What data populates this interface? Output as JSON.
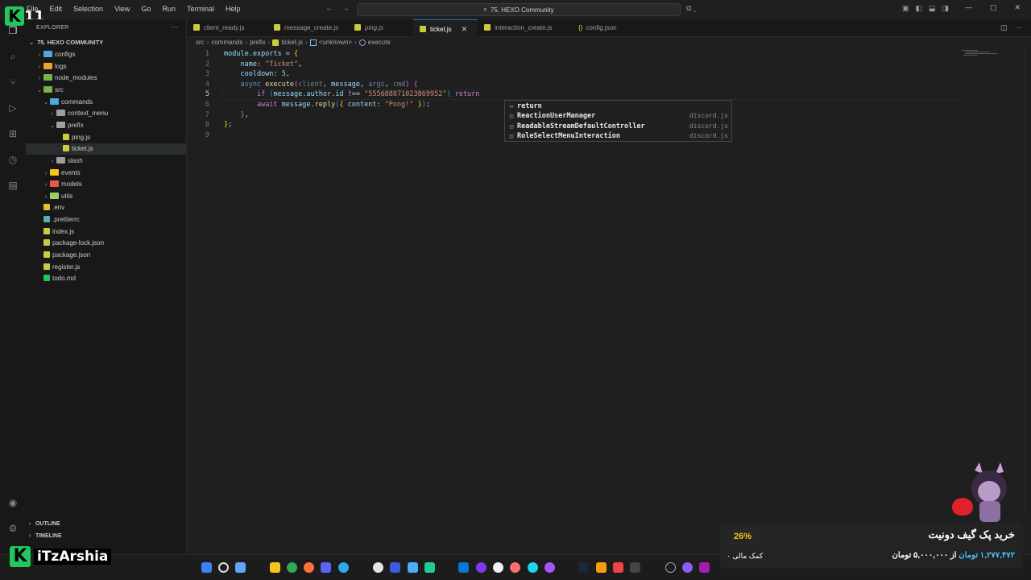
{
  "logo": {
    "number": "11"
  },
  "menu": [
    "File",
    "Edit",
    "Selection",
    "View",
    "Go",
    "Run",
    "Terminal",
    "Help"
  ],
  "search": {
    "text": "75. HEXO Community"
  },
  "sidebar": {
    "header": "EXPLORER",
    "root": "75. HEXO COMMUNITY",
    "items": [
      {
        "label": "configs",
        "depth": 1,
        "chevron": "›",
        "icon_color": "#4ea8de",
        "kind": "folder"
      },
      {
        "label": "logs",
        "depth": 1,
        "chevron": "›",
        "icon_color": "#e8a33b",
        "kind": "folder"
      },
      {
        "label": "node_modules",
        "depth": 1,
        "chevron": "›",
        "icon_color": "#7cb342",
        "kind": "folder"
      },
      {
        "label": "src",
        "depth": 1,
        "chevron": "⌄",
        "icon_color": "#7cb342",
        "kind": "folder"
      },
      {
        "label": "commands",
        "depth": 2,
        "chevron": "⌄",
        "icon_color": "#4ea8de",
        "kind": "folder"
      },
      {
        "label": "context_menu",
        "depth": 3,
        "chevron": "›",
        "icon_color": "#9e9e9e",
        "kind": "folder"
      },
      {
        "label": "prefix",
        "depth": 3,
        "chevron": "⌄",
        "icon_color": "#9e9e9e",
        "kind": "folder"
      },
      {
        "label": "ping.js",
        "depth": 4,
        "chevron": "",
        "icon_color": "#cbcb41",
        "kind": "file"
      },
      {
        "label": "ticket.js",
        "depth": 4,
        "chevron": "",
        "icon_color": "#cbcb41",
        "kind": "file",
        "selected": true
      },
      {
        "label": "slash",
        "depth": 3,
        "chevron": "›",
        "icon_color": "#9e9e9e",
        "kind": "folder"
      },
      {
        "label": "events",
        "depth": 2,
        "chevron": "›",
        "icon_color": "#f5c518",
        "kind": "folder"
      },
      {
        "label": "models",
        "depth": 2,
        "chevron": "›",
        "icon_color": "#ef5350",
        "kind": "folder"
      },
      {
        "label": "utils",
        "depth": 2,
        "chevron": "›",
        "icon_color": "#9ccc65",
        "kind": "folder"
      },
      {
        "label": ".env",
        "depth": 1,
        "chevron": "",
        "icon_color": "#e6c229",
        "kind": "file"
      },
      {
        "label": ".prettierrc",
        "depth": 1,
        "chevron": "",
        "icon_color": "#56b3b4",
        "kind": "file"
      },
      {
        "label": "index.js",
        "depth": 1,
        "chevron": "",
        "icon_color": "#cbcb41",
        "kind": "file"
      },
      {
        "label": "package-lock.json",
        "depth": 1,
        "chevron": "",
        "icon_color": "#cbcb41",
        "kind": "file"
      },
      {
        "label": "package.json",
        "depth": 1,
        "chevron": "",
        "icon_color": "#cbcb41",
        "kind": "file"
      },
      {
        "label": "register.js",
        "depth": 1,
        "chevron": "",
        "icon_color": "#cbcb41",
        "kind": "file"
      },
      {
        "label": "todo.md",
        "depth": 1,
        "chevron": "",
        "icon_color": "#22c55e",
        "kind": "file"
      }
    ],
    "outline": "OUTLINE",
    "timeline": "TIMELINE"
  },
  "tabs": [
    {
      "label": "client_ready.js",
      "icon": "js",
      "active": false,
      "italic": false
    },
    {
      "label": "message_create.js",
      "icon": "js",
      "active": false,
      "italic": false
    },
    {
      "label": "ping.js",
      "icon": "js",
      "active": false,
      "italic": true
    },
    {
      "label": "ticket.js",
      "icon": "js",
      "active": true,
      "italic": false
    },
    {
      "label": "interaction_create.js",
      "icon": "js",
      "active": false,
      "italic": false
    },
    {
      "label": "config.json",
      "icon": "json",
      "active": false,
      "italic": false
    }
  ],
  "breadcrumb": [
    "src",
    "commands",
    "prefix",
    "ticket.js",
    "<unknown>",
    "execute"
  ],
  "line_numbers": [
    "1",
    "2",
    "3",
    "4",
    "5",
    "6",
    "7",
    "8",
    "9"
  ],
  "code_lines": [
    {
      "indent": "",
      "tokens": [
        {
          "t": "module",
          "c": "var"
        },
        {
          "t": ".",
          "c": ""
        },
        {
          "t": "exports",
          "c": "var"
        },
        {
          "t": " = ",
          "c": ""
        },
        {
          "t": "{",
          "c": "br1"
        }
      ]
    },
    {
      "indent": "    ",
      "tokens": [
        {
          "t": "name",
          "c": "prop"
        },
        {
          "t": ": ",
          "c": ""
        },
        {
          "t": "\"Ticket\"",
          "c": "str"
        },
        {
          "t": ",",
          "c": ""
        }
      ]
    },
    {
      "indent": "    ",
      "tokens": [
        {
          "t": "cooldown",
          "c": "prop"
        },
        {
          "t": ": ",
          "c": ""
        },
        {
          "t": "5",
          "c": "num"
        },
        {
          "t": ",",
          "c": ""
        }
      ]
    },
    {
      "indent": "    ",
      "tokens": [
        {
          "t": "async",
          "c": "kb"
        },
        {
          "t": " ",
          "c": ""
        },
        {
          "t": "execute",
          "c": "fn"
        },
        {
          "t": "(",
          "c": "br2"
        },
        {
          "t": "client",
          "c": "prm"
        },
        {
          "t": ", ",
          "c": ""
        },
        {
          "t": "message",
          "c": "var"
        },
        {
          "t": ", ",
          "c": ""
        },
        {
          "t": "args",
          "c": "prm"
        },
        {
          "t": ", ",
          "c": ""
        },
        {
          "t": "cmd",
          "c": "prm"
        },
        {
          "t": ")",
          "c": "br2"
        },
        {
          "t": " ",
          "c": ""
        },
        {
          "t": "{",
          "c": "br2"
        }
      ]
    },
    {
      "indent": "        ",
      "tokens": [
        {
          "t": "if",
          "c": "kw"
        },
        {
          "t": " ",
          "c": ""
        },
        {
          "t": "(",
          "c": "br3"
        },
        {
          "t": "message",
          "c": "var"
        },
        {
          "t": ".",
          "c": ""
        },
        {
          "t": "author",
          "c": "var"
        },
        {
          "t": ".",
          "c": ""
        },
        {
          "t": "id",
          "c": "var"
        },
        {
          "t": " !== ",
          "c": ""
        },
        {
          "t": "\"555688871023869952\"",
          "c": "str"
        },
        {
          "t": ")",
          "c": "br3"
        },
        {
          "t": " ",
          "c": ""
        },
        {
          "t": "return",
          "c": "kw"
        }
      ]
    },
    {
      "indent": "        ",
      "tokens": [
        {
          "t": "await",
          "c": "kw"
        },
        {
          "t": " ",
          "c": ""
        },
        {
          "t": "message",
          "c": "var"
        },
        {
          "t": ".",
          "c": ""
        },
        {
          "t": "reply",
          "c": "fn"
        },
        {
          "t": "(",
          "c": "br3"
        },
        {
          "t": "{",
          "c": "br1"
        },
        {
          "t": " ",
          "c": ""
        },
        {
          "t": "content",
          "c": "prop"
        },
        {
          "t": ": ",
          "c": ""
        },
        {
          "t": "\"Pong!\"",
          "c": "str"
        },
        {
          "t": " ",
          "c": ""
        },
        {
          "t": "}",
          "c": "br1"
        },
        {
          "t": ")",
          "c": "br3"
        },
        {
          "t": ";",
          "c": ""
        }
      ]
    },
    {
      "indent": "    ",
      "tokens": [
        {
          "t": "}",
          "c": "br2"
        },
        {
          "t": ",",
          "c": ""
        }
      ]
    },
    {
      "indent": "",
      "tokens": [
        {
          "t": "}",
          "c": "br1"
        },
        {
          "t": ";",
          "c": ""
        }
      ]
    },
    {
      "indent": "",
      "tokens": []
    }
  ],
  "suggestions": [
    {
      "label": "return",
      "detail": "",
      "icon": "keyword-icon"
    },
    {
      "label": "ReactionUserManager",
      "detail": "discord.js",
      "icon": "class-icon"
    },
    {
      "label": "ReadableStreamDefaultController",
      "detail": "discord.js",
      "icon": "class-icon"
    },
    {
      "label": "RoleSelectMenuInteraction",
      "detail": "discord.js",
      "icon": "class-icon"
    }
  ],
  "brand": {
    "name": "iTzArshia"
  },
  "donate": {
    "percent": "26%",
    "count": "۰ کمک مالی",
    "title": "خرید پک گیف دونیت",
    "amount_current": "۱,۲۷۷,۴۷۲ تومان",
    "amount_rest": " از ۵,۰۰۰,۰۰۰ تومان"
  }
}
